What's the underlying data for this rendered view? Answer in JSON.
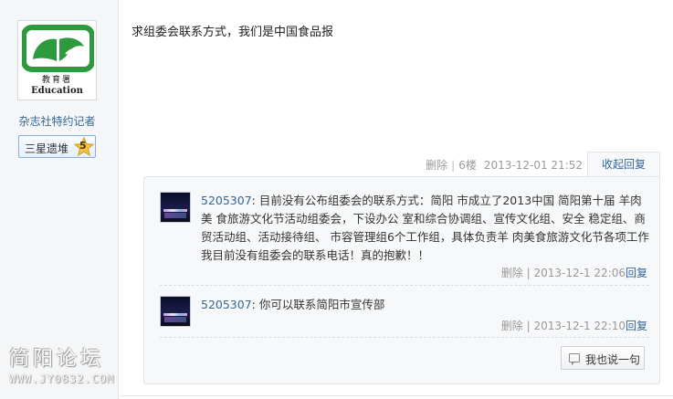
{
  "author": {
    "avatar_text_cn": "教育署",
    "avatar_text_en": "Education",
    "title": "杂志社特约记者",
    "rank": {
      "label": "三星遗堆",
      "level": "5"
    }
  },
  "post": {
    "content": "求组委会联系方式，我们是中国食品报",
    "meta": {
      "delete": "删除",
      "floor": "6楼",
      "datetime": "2013-12-01 21:52"
    },
    "collapse_label": "收起回复"
  },
  "replies": [
    {
      "user": "5205307",
      "text": "目前没有公布组委会的联系方式：简阳 市成立了2013中国 简阳第十届 羊肉美 食旅游文化节活动组委会，下设办公 室和综合协调组、宣传文化组、安全 稳定组、商贸活动组、活动接待组、 市容管理组6个工作组，具体负责羊 肉美食旅游文化节各项工作我目前没有组委会的联系电话！真的抱歉！！",
      "delete": "删除",
      "datetime": "2013-12-1 22:06",
      "reply": "回复"
    },
    {
      "user": "5205307",
      "text": "你可以联系简阳市宣传部",
      "delete": "删除",
      "datetime": "2013-12-1 22:10",
      "reply": "回复"
    }
  ],
  "say_button": "我也说一句",
  "watermark": {
    "title": "简阳论坛",
    "url": "WWW.JY0832.COM"
  },
  "colors": {
    "link": "#336699",
    "muted": "#999999",
    "logo_green": "#2e9a3e"
  }
}
